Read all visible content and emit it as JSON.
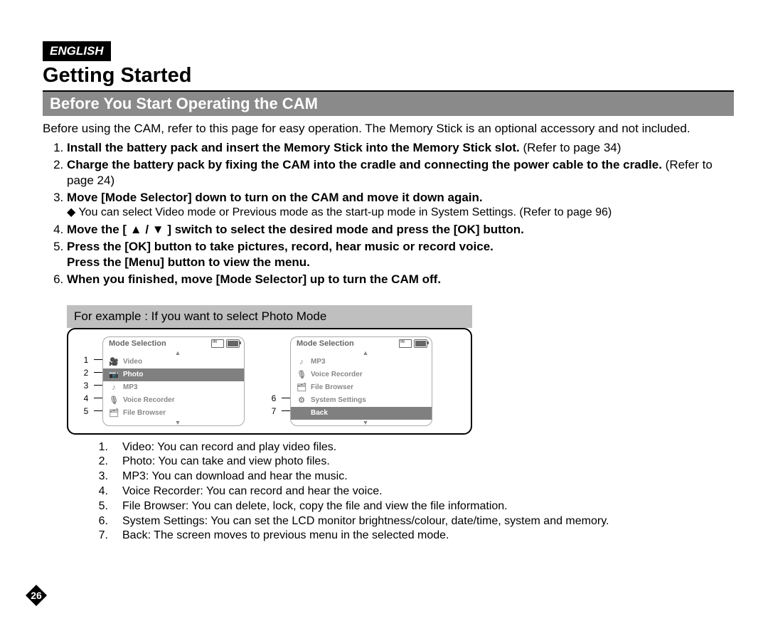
{
  "language_badge": "ENGLISH",
  "title": "Getting Started",
  "section_heading": "Before You Start Operating the CAM",
  "intro": "Before using the CAM, refer to this page for easy operation. The Memory Stick is an optional accessory and not included.",
  "steps": {
    "s1_bold": "Install the battery pack and insert the Memory Stick into the Memory Stick slot.",
    "s1_note": " (Refer to page 34)",
    "s2_bold": "Charge the battery pack by fixing the CAM into the cradle and connecting the power cable to the cradle.",
    "s2_note": " (Refer to page 24)",
    "s3_bold": "Move [Mode Selector] down to turn on the CAM and move it down again.",
    "s3_sub": "You can select Video mode or Previous mode as the start-up mode in System Settings. (Refer to page 96)",
    "s4_bold": "Move the [ ▲ / ▼ ] switch to select the desired mode and press the [OK] button.",
    "s5_bold_a": "Press the [OK] button to take pictures, record, hear music or record voice.",
    "s5_bold_b": "Press the [Menu] button to view the menu.",
    "s6_bold": "When you finished, move [Mode Selector] up to turn the CAM off."
  },
  "example": {
    "title": "For example : If you want to select Photo Mode",
    "screen_header": "Mode Selection",
    "left": {
      "numbers": [
        "1",
        "2",
        "3",
        "4",
        "5"
      ],
      "items": [
        {
          "icon": "🎥",
          "label": "Video",
          "selected": false
        },
        {
          "icon": "📷",
          "label": "Photo",
          "selected": true
        },
        {
          "icon": "♪",
          "label": "MP3",
          "selected": false
        },
        {
          "icon": "🎙",
          "label": "Voice Recorder",
          "selected": false
        },
        {
          "icon": "🗂",
          "label": "File Browser",
          "selected": false
        }
      ]
    },
    "right": {
      "numbers": [
        "6",
        "7"
      ],
      "items": [
        {
          "icon": "♪",
          "label": "MP3",
          "selected": false
        },
        {
          "icon": "🎙",
          "label": "Voice Recorder",
          "selected": false
        },
        {
          "icon": "🗂",
          "label": "File Browser",
          "selected": false
        },
        {
          "icon": "⚙",
          "label": "System Settings",
          "selected": false
        },
        {
          "icon": "",
          "label": "Back",
          "selected": true
        }
      ]
    }
  },
  "descriptions": [
    {
      "n": "1.",
      "t": "Video: You can record and play video files."
    },
    {
      "n": "2.",
      "t": "Photo: You can take and view photo files."
    },
    {
      "n": "3.",
      "t": "MP3: You can download and hear the music."
    },
    {
      "n": "4.",
      "t": "Voice Recorder: You can record and hear the voice."
    },
    {
      "n": "5.",
      "t": "File Browser: You can delete, lock, copy the file and view the file information."
    },
    {
      "n": "6.",
      "t": "System Settings: You can set the LCD monitor brightness/colour, date/time, system and memory."
    },
    {
      "n": "7.",
      "t": "Back: The screen moves to previous menu in the selected mode."
    }
  ],
  "page_number": "26"
}
